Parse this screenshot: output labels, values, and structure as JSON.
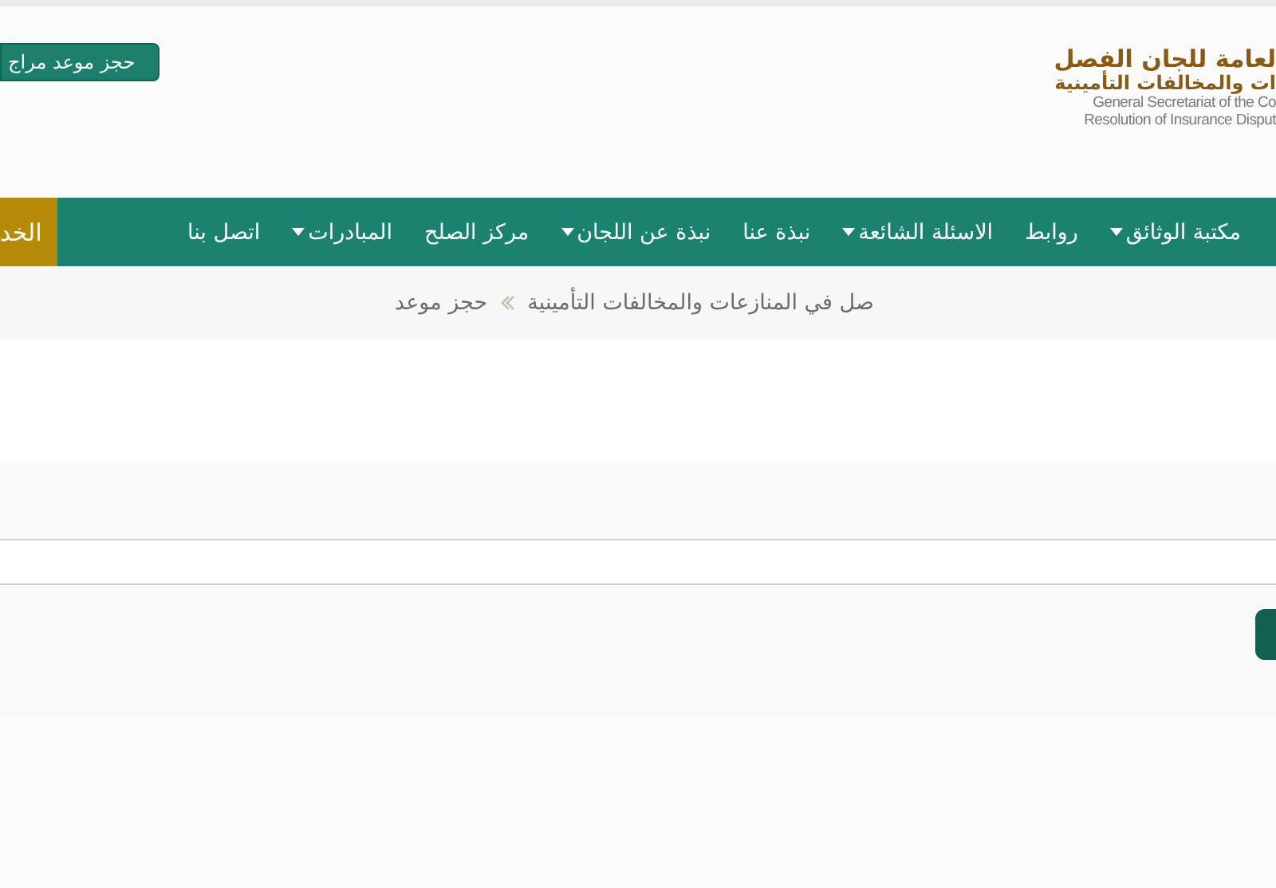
{
  "header": {
    "booking_button": "حجز موعد مراج",
    "logo": {
      "arabic_lines": [
        "لعامة للجان الفصل",
        "ات والمخالفات التأمينية"
      ],
      "english_lines": [
        "General Secretariat of the Co",
        "Resolution of Insurance Disput"
      ]
    }
  },
  "nav": {
    "items": [
      {
        "label": "مكتبة الوثائق",
        "has_menu": true
      },
      {
        "label": "روابط",
        "has_menu": false
      },
      {
        "label": "الاسئلة الشائعة",
        "has_menu": true
      },
      {
        "label": "نبذة عنا",
        "has_menu": false
      },
      {
        "label": "نبذة عن اللجان",
        "has_menu": true
      },
      {
        "label": "مركز الصلح",
        "has_menu": false
      },
      {
        "label": "المبادرات",
        "has_menu": true
      },
      {
        "label": "اتصل بنا",
        "has_menu": false
      }
    ],
    "services": {
      "label": "الخد",
      "highlighted": true
    }
  },
  "breadcrumb": [
    "صل في المنازعات والمخالفات التأمينية",
    "حجز موعد"
  ]
}
